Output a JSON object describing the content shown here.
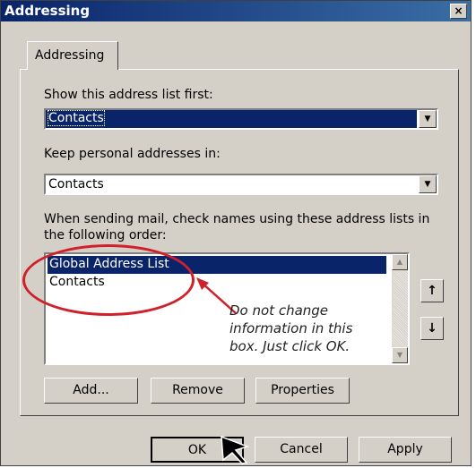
{
  "title": "Addressing",
  "close_glyph": "×",
  "tab_label": "Addressing",
  "show_label": "Show this address list first:",
  "show_value": "Contacts",
  "keep_label": "Keep personal addresses in:",
  "keep_value": "Contacts",
  "check_label_1": "When sending mail, check names using these address lists in",
  "check_label_2": "the following order:",
  "list_items": [
    "Global Address List",
    "Contacts"
  ],
  "annotation": [
    "Do not change",
    "information in this",
    "box. Just click OK."
  ],
  "move_up": "↑",
  "move_down": "↓",
  "buttons": {
    "add": "Add...",
    "remove": "Remove",
    "properties": "Properties",
    "ok": "OK",
    "cancel": "Cancel",
    "apply": "Apply"
  },
  "colors": {
    "selection": "#0a246a",
    "annotation": "#d0202a"
  },
  "icons": [
    "close-icon",
    "dropdown-icon",
    "scroll-up-icon",
    "scroll-down-icon",
    "move-up-icon",
    "move-down-icon",
    "mouse-pointer-icon"
  ]
}
